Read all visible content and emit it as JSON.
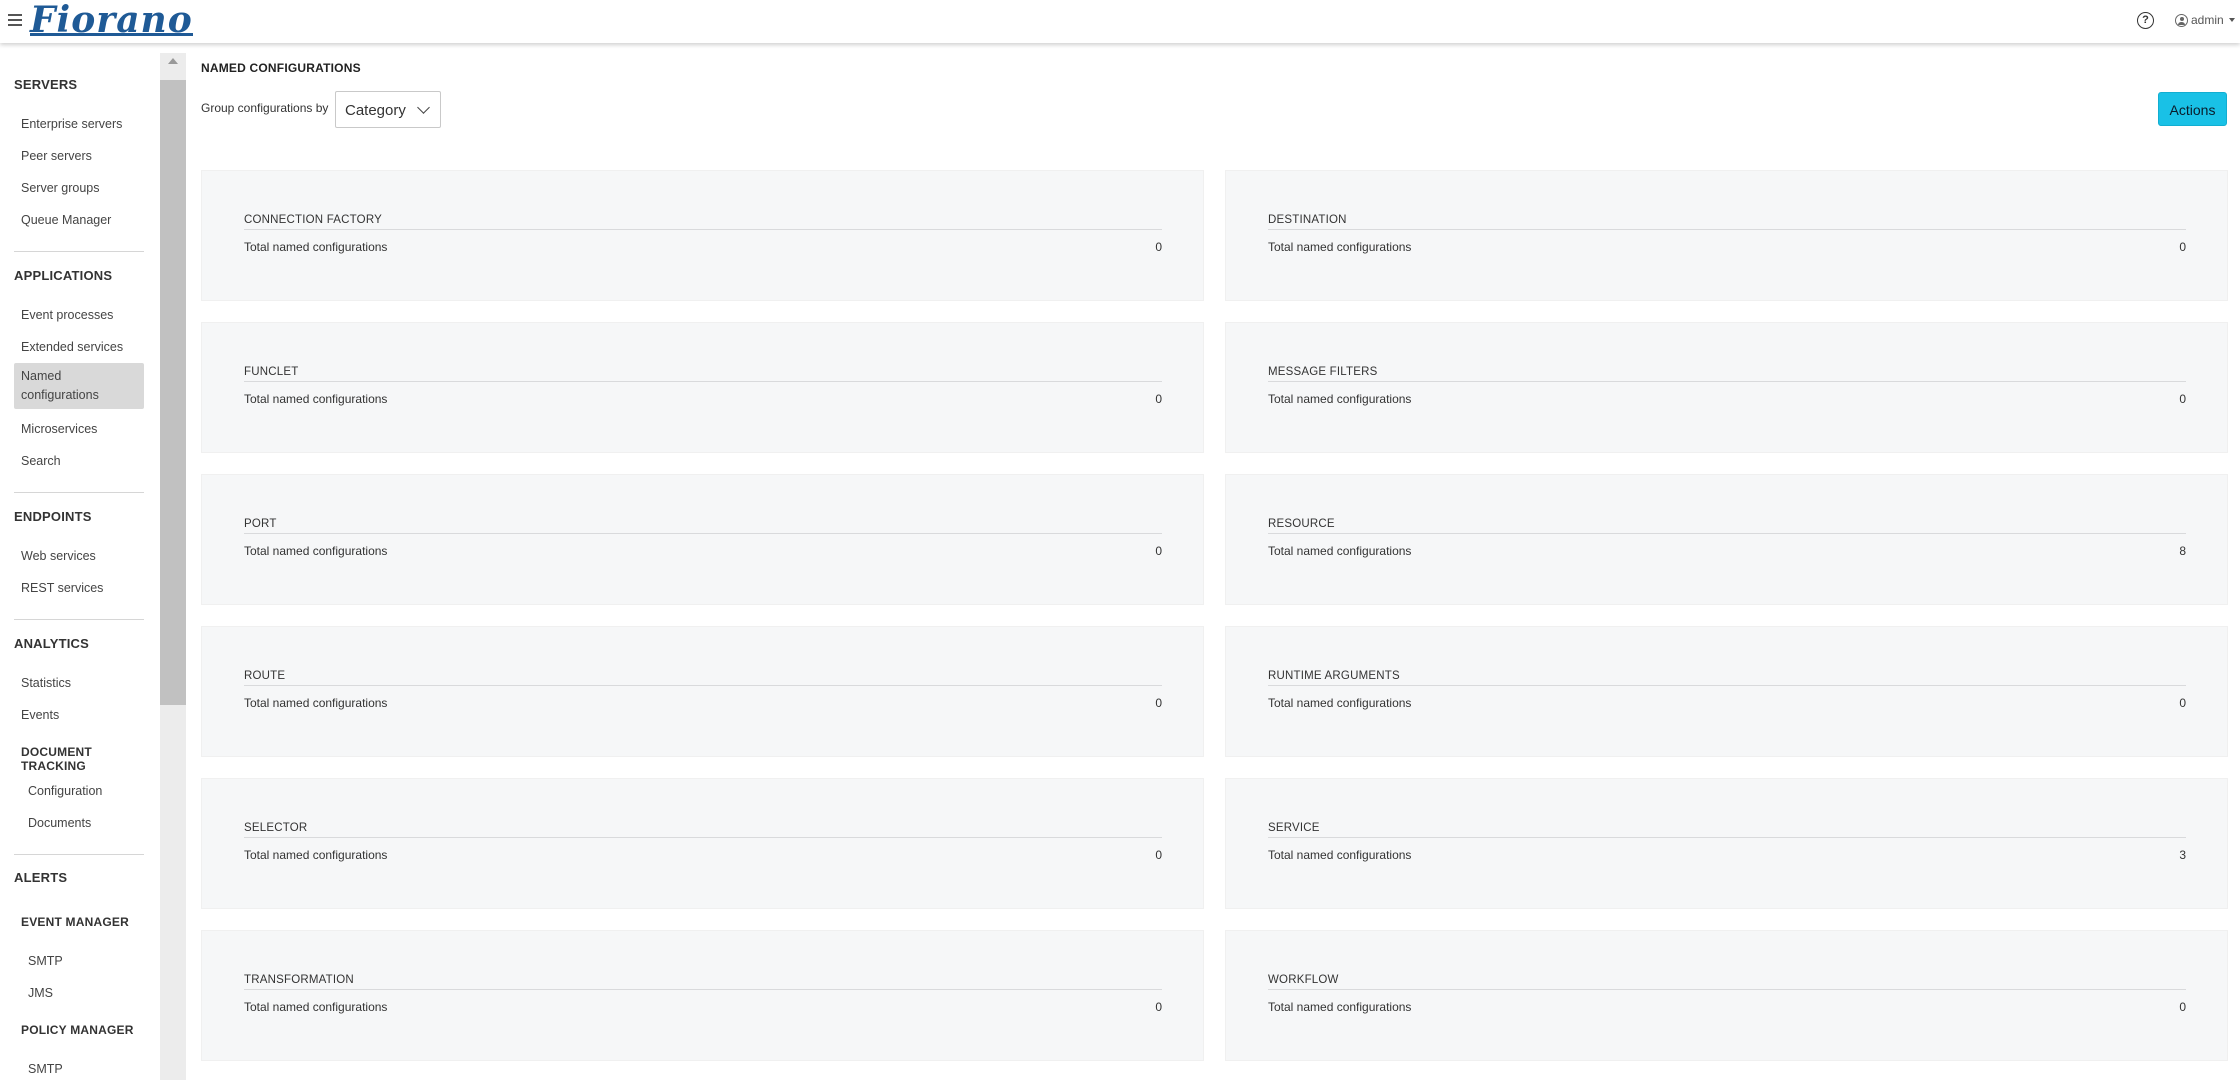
{
  "header": {
    "logo_text": "Fiorano",
    "help_symbol": "?",
    "user": "admin",
    "brand_color": "#1f5a96"
  },
  "sidebar": {
    "servers": {
      "title": "SERVERS",
      "items": [
        "Enterprise servers",
        "Peer servers",
        "Server groups",
        "Queue Manager"
      ]
    },
    "applications": {
      "title": "APPLICATIONS",
      "items": [
        "Event processes",
        "Extended services",
        "Named configurations",
        "Microservices",
        "Search"
      ],
      "active_index": 2
    },
    "endpoints": {
      "title": "ENDPOINTS",
      "items": [
        "Web services",
        "REST services"
      ]
    },
    "analytics": {
      "title": "ANALYTICS",
      "items": [
        "Statistics",
        "Events"
      ],
      "document_tracking": {
        "title": "DOCUMENT TRACKING",
        "items": [
          "Configuration",
          "Documents"
        ]
      }
    },
    "alerts": {
      "title": "ALERTS",
      "event_manager": {
        "title": "EVENT MANAGER",
        "items": [
          "SMTP",
          "JMS"
        ]
      },
      "policy_manager": {
        "title": "POLICY MANAGER",
        "items": [
          "SMTP"
        ]
      }
    }
  },
  "main": {
    "title": "NAMED CONFIGURATIONS",
    "group_label": "Group configurations by",
    "group_select_value": "Category",
    "actions_label": "Actions",
    "accent_color": "#19c1e6",
    "card_label": "Total named configurations",
    "cards": [
      {
        "title": "CONNECTION FACTORY",
        "count": "0"
      },
      {
        "title": "DESTINATION",
        "count": "0"
      },
      {
        "title": "FUNCLET",
        "count": "0"
      },
      {
        "title": "MESSAGE FILTERS",
        "count": "0"
      },
      {
        "title": "PORT",
        "count": "0"
      },
      {
        "title": "RESOURCE",
        "count": "8"
      },
      {
        "title": "ROUTE",
        "count": "0"
      },
      {
        "title": "RUNTIME ARGUMENTS",
        "count": "0"
      },
      {
        "title": "SELECTOR",
        "count": "0"
      },
      {
        "title": "SERVICE",
        "count": "3"
      },
      {
        "title": "TRANSFORMATION",
        "count": "0"
      },
      {
        "title": "WORKFLOW",
        "count": "0"
      }
    ]
  }
}
